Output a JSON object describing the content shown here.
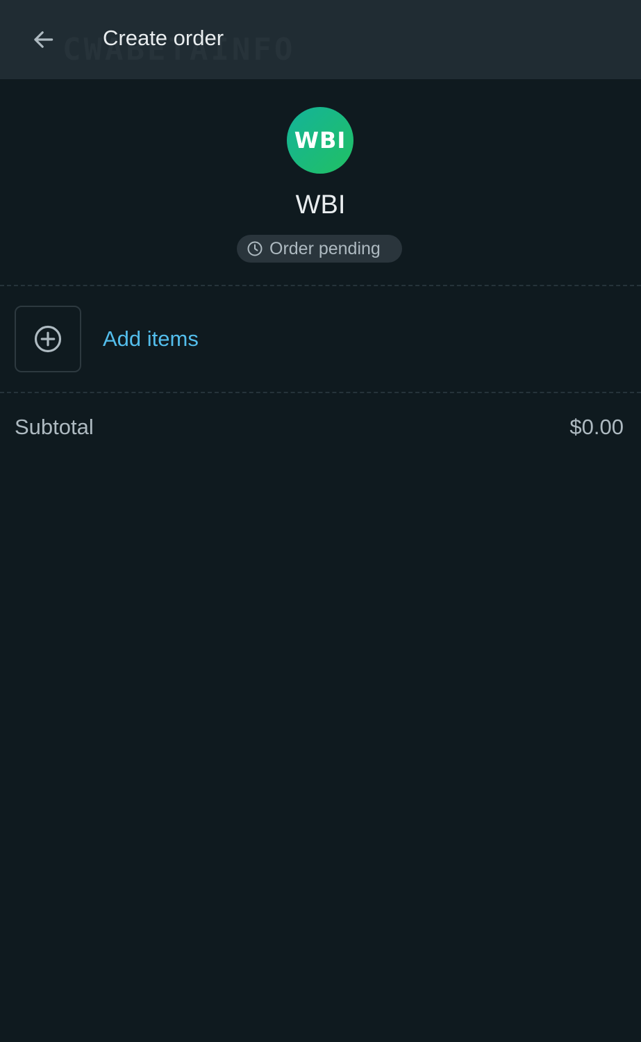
{
  "header": {
    "title": "Create order",
    "back_icon": "arrow-left-icon",
    "watermark": "CWABETAINFO"
  },
  "business": {
    "avatar_text": "WBI",
    "name": "WBI"
  },
  "status": {
    "icon": "clock-icon",
    "label": "Order pending"
  },
  "items": {
    "add_icon": "plus-circle-icon",
    "add_label": "Add items"
  },
  "summary": {
    "subtotal_label": "Subtotal",
    "subtotal_value": "$0.00"
  },
  "colors": {
    "background": "#0f1a1f",
    "header": "#202c33",
    "accent_link": "#53bdeb",
    "avatar_gradient_start": "#14b39a",
    "avatar_gradient_end": "#21c063"
  }
}
